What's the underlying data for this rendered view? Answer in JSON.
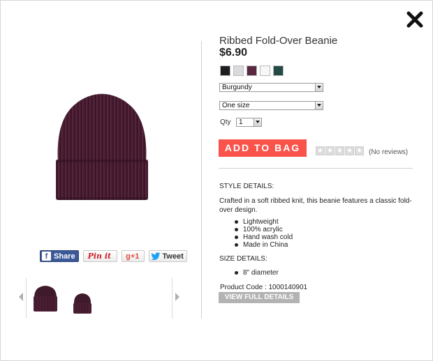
{
  "product": {
    "title": "Ribbed Fold-Over Beanie",
    "price": "$6.90",
    "swatches": [
      {
        "name": "black",
        "color": "#1e1e22"
      },
      {
        "name": "light-gray",
        "color": "#d8dadc"
      },
      {
        "name": "burgundy",
        "color": "#5a2840"
      },
      {
        "name": "white",
        "color": "#f7f7f7"
      },
      {
        "name": "dark-green",
        "color": "#244a45"
      }
    ],
    "color_select": "Burgundy",
    "size_select": "One size",
    "qty_label": "Qty",
    "qty_value": "1",
    "add_to_bag": "ADD TO BAG",
    "rating_stars": 0,
    "reviews": "(No reviews)",
    "style_heading": "STYLE DETAILS:",
    "description": "Crafted in a soft ribbed knit, this beanie features a classic fold-over design.",
    "features": [
      "Lightweight",
      "100% acrylic",
      "Hand wash cold",
      "Made in China"
    ],
    "size_heading": "SIZE DETAILS:",
    "size_details": [
      "8\" diameter"
    ],
    "product_code": "Product Code : 1000140901",
    "view_full": "VIEW FULL DETAILS"
  },
  "share": {
    "facebook": "Share",
    "pinterest": "Pin it",
    "gplus": "g+1",
    "twitter": "Tweet"
  },
  "icons": {
    "close": "close-icon",
    "prev": "chevron-left-icon",
    "next": "chevron-right-icon"
  },
  "colors": {
    "add_button": "#f9534b",
    "beanie": "#4a1e33",
    "view_button": "#b3b3b3"
  }
}
